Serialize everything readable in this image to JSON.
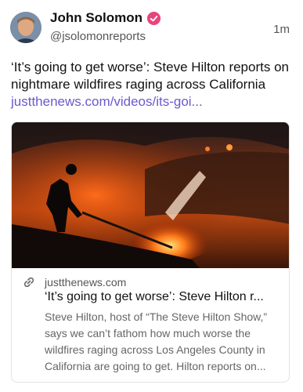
{
  "author": {
    "name": "John Solomon",
    "handle": "@jsolomonreports",
    "time": "1m"
  },
  "post": {
    "text": "‘It’s going to get worse’: Steve Hilton reports on nightmare wildfires raging across California ",
    "link_text": "justthenews.com/videos/its-goi..."
  },
  "card": {
    "domain": "justthenews.com",
    "title": "‘It’s going to get worse’: Steve Hilton r...",
    "description": "Steve Hilton, host of “The Steve Hilton Show,” says we can’t fathom how much worse the wildfires raging across Los Angeles County in California are going to get. Hilton reports on..."
  },
  "colors": {
    "link": "#6a5acd",
    "verified": "#e8457a"
  },
  "icons": [
    "verified-badge-icon",
    "link-icon"
  ]
}
